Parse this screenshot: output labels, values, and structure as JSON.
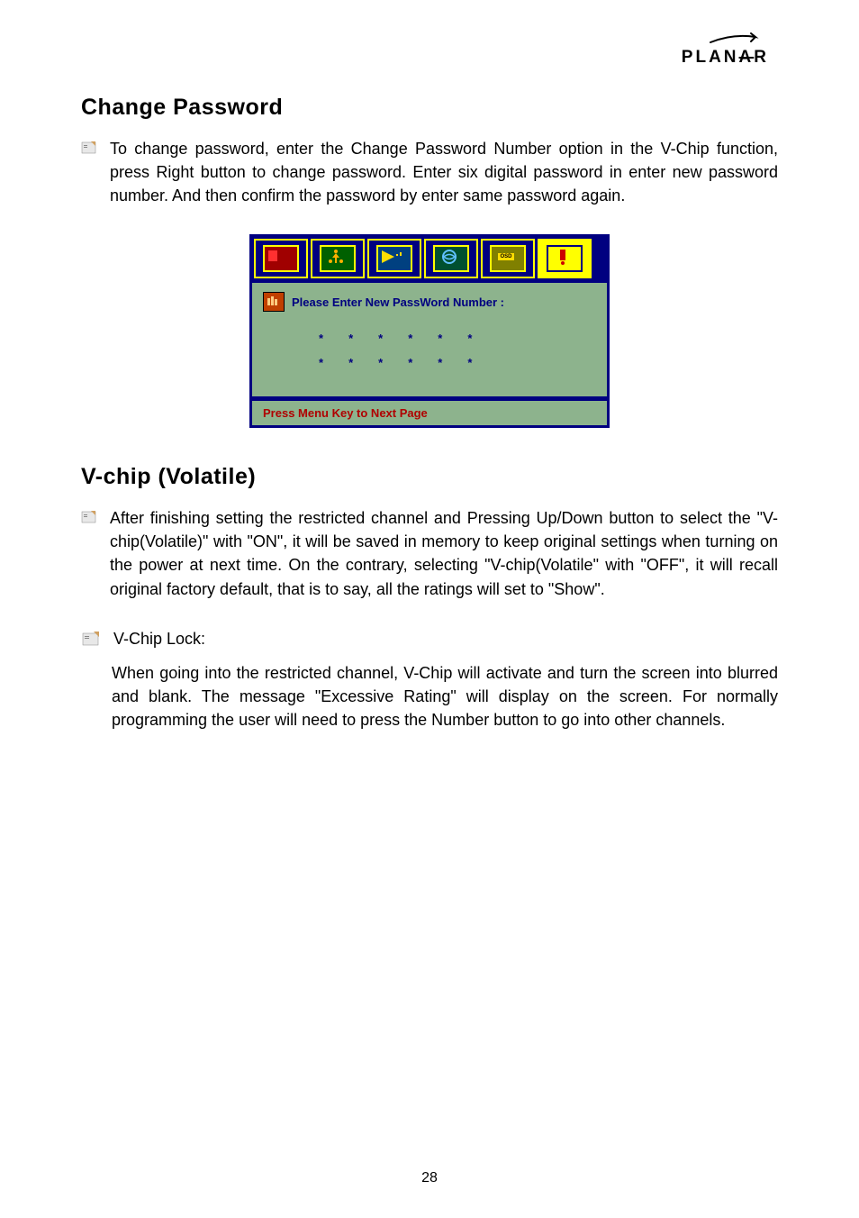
{
  "logo": {
    "text_part1": "PLAN",
    "text_part2": "A",
    "text_part3": "R"
  },
  "sections": {
    "change_password": {
      "heading": "Change Password",
      "body": "To change password, enter the Change Password Number option in the V-Chip function, press Right button to change password. Enter six digital password in enter new password number. And then confirm the password by enter same password again."
    },
    "vchip_volatile": {
      "heading": "V-chip (Volatile)",
      "body": "After finishing setting the restricted channel and Pressing Up/Down button to select the \"V-chip(Volatile)\" with \"ON\", it will be saved in memory to keep original settings when turning on the power at next time. On the contrary, selecting \"V-chip(Volatile\" with \"OFF\", it will recall original factory default, that is to say, all the ratings will set to \"Show\"."
    },
    "vchip_lock": {
      "heading": "V-Chip Lock:",
      "body": "When going into the restricted channel, V-Chip will activate and turn the screen into blurred and blank. The message \"Excessive Rating\" will display on the screen. For normally programming the user will need to press the Number button to go into other channels."
    }
  },
  "osd": {
    "prompt": "Please Enter New PassWord Number :",
    "stars_row1": [
      "*",
      "*",
      "*",
      "*",
      "*",
      "*"
    ],
    "stars_row2": [
      "*",
      "*",
      "*",
      "*",
      "*",
      "*"
    ],
    "footer": "Press Menu Key to Next Page"
  },
  "page_number": "28"
}
